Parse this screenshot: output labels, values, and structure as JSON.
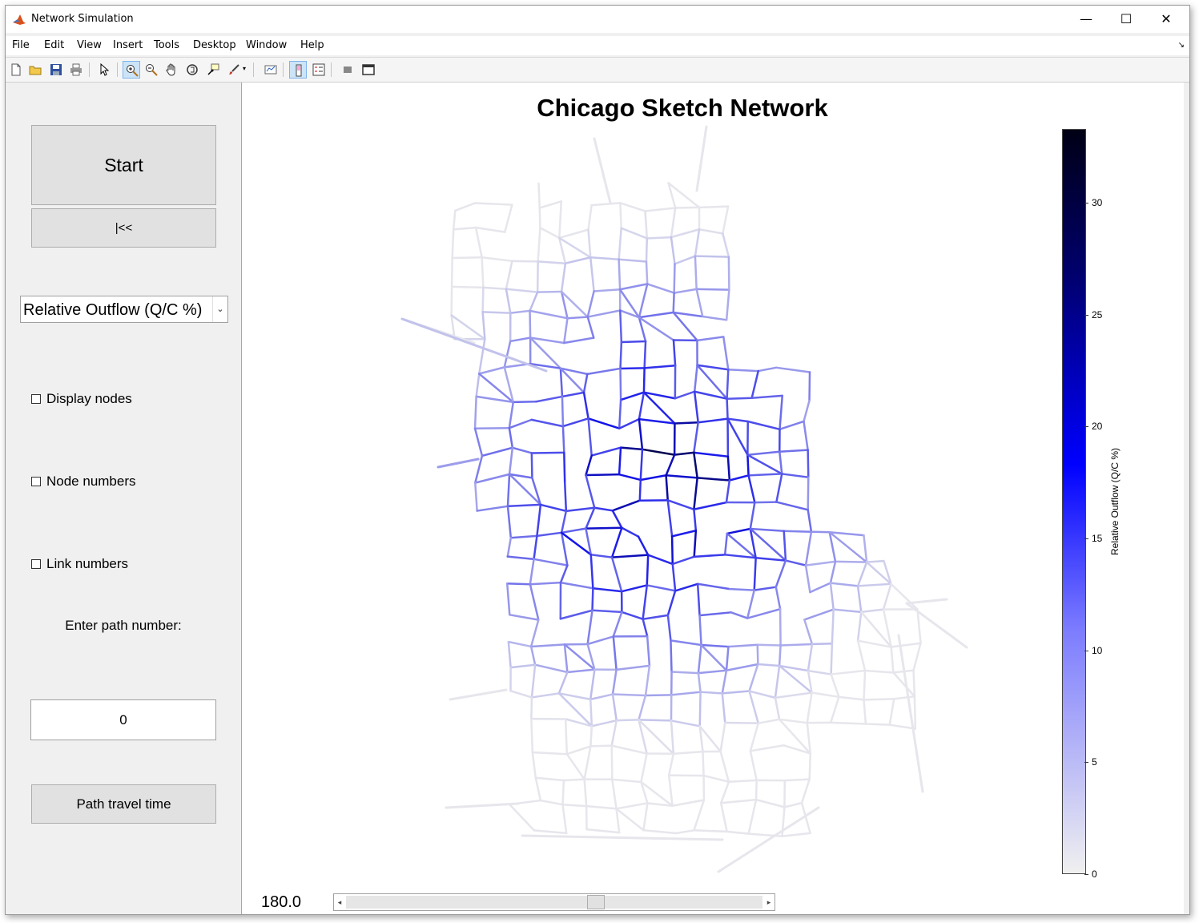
{
  "window": {
    "title": "Network Simulation",
    "controls": {
      "minimize": "—",
      "maximize": "☐",
      "close": "✕"
    }
  },
  "menu": [
    "File",
    "Edit",
    "View",
    "Insert",
    "Tools",
    "Desktop",
    "Window",
    "Help"
  ],
  "toolbar": {
    "icons": [
      "new-figure-icon",
      "open-file-icon",
      "save-icon",
      "print-icon",
      "pointer-icon",
      "zoom-in-icon",
      "zoom-out-icon",
      "pan-icon",
      "rotate-3d-icon",
      "data-cursor-icon",
      "brush-icon",
      "link-plot-icon",
      "colorbar-icon",
      "legend-icon",
      "hide-tools-icon",
      "dock-icon"
    ],
    "active": [
      "zoom-in-icon",
      "colorbar-icon"
    ]
  },
  "controls": {
    "start_label": "Start",
    "rewind_label": "|<<",
    "metric_select": {
      "value": "Relative Outflow (Q/C %)"
    },
    "display_nodes_label": "Display nodes",
    "node_numbers_label": "Node numbers",
    "link_numbers_label": "Link numbers",
    "display_nodes_checked": false,
    "node_numbers_checked": false,
    "link_numbers_checked": false,
    "path_prompt": "Enter path number:",
    "path_number": "0",
    "path_travel_time_label": "Path travel time"
  },
  "plot": {
    "title": "Chicago Sketch Network",
    "colorbar": {
      "label": "Relative Outflow (Q/C %)",
      "ticks": [
        "0",
        "5",
        "10",
        "15",
        "20",
        "25",
        "30"
      ],
      "min": 0,
      "max": 33.3,
      "colors": {
        "low": "#f0f0f0",
        "mid": "#0000ff",
        "high": "#000015"
      }
    }
  },
  "time": {
    "value": "180.0",
    "slider_position": 0.6
  }
}
